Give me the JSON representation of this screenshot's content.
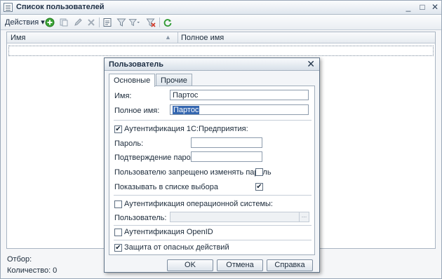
{
  "window": {
    "title": "Список пользователей",
    "controls": {
      "minimize": "_",
      "maximize": "□",
      "close": "✕"
    }
  },
  "toolbar": {
    "actions_label": "Действия",
    "icons": [
      "add-icon",
      "copy-icon",
      "edit-icon",
      "delete-icon",
      "view-icon",
      "filter-icon",
      "filter-list-icon",
      "filter-clear-icon",
      "refresh-icon"
    ]
  },
  "table": {
    "columns": [
      "Имя",
      "Полное имя"
    ],
    "rows": []
  },
  "footer": {
    "filter_label": "Отбор:",
    "count_label": "Количество: 0"
  },
  "dialog": {
    "title": "Пользователь",
    "close": "✕",
    "tabs": [
      "Основные",
      "Прочие"
    ],
    "name_label": "Имя:",
    "name_value": "Партос",
    "fullname_label": "Полное имя:",
    "fullname_value": "Партос",
    "auth1c_label": "Аутентификация 1С:Предприятия:",
    "auth1c_checked": true,
    "password_label": "Пароль:",
    "password_value": "",
    "confirm_label": "Подтверждение пароля:",
    "confirm_value": "",
    "forbid_label": "Пользователю запрещено изменять пароль",
    "forbid_checked": false,
    "show_label": "Показывать в списке выбора",
    "show_checked": true,
    "authos_label": "Аутентификация операционной системы:",
    "authos_checked": false,
    "user_label": "Пользователь:",
    "user_value": "",
    "openid_label": "Аутентификация OpenID",
    "openid_checked": false,
    "protect_label": "Защита от опасных действий",
    "protect_checked": true,
    "ok": "OK",
    "cancel": "Отмена",
    "help": "Справка"
  }
}
